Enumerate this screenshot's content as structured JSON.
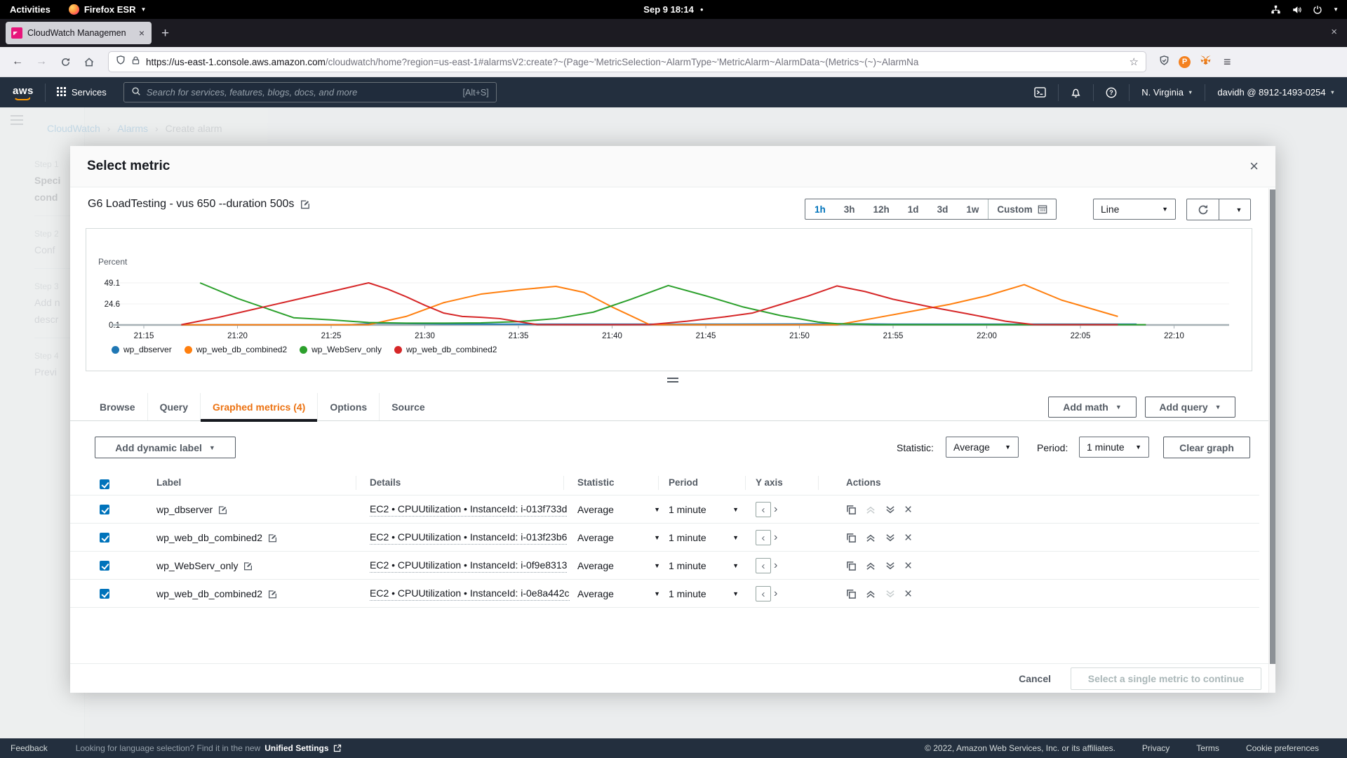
{
  "os": {
    "activities": "Activities",
    "browser_menu": "Firefox ESR",
    "clock": "Sep 9 18:14"
  },
  "browser": {
    "tab_title": "CloudWatch Managemen",
    "new_tab": "+",
    "url_domain": "https://us-east-1.console.aws.amazon.com",
    "url_path": "/cloudwatch/home?region=us-east-1#alarmsV2:create?~(Page~'MetricSelection~AlarmType~'MetricAlarm~AlarmData~(Metrics~(~)~AlarmNa"
  },
  "awsnav": {
    "services_label": "Services",
    "search_placeholder": "Search for services, features, blogs, docs, and more",
    "search_shortcut": "[Alt+S]",
    "region": "N. Virginia",
    "account": "davidh @ 8912-1493-0254"
  },
  "bg": {
    "breadcrumb": {
      "a": "CloudWatch",
      "b": "Alarms",
      "c": "Create alarm"
    },
    "steps": [
      {
        "k": "Step 1",
        "t1": "Speci",
        "t2": "cond"
      },
      {
        "k": "Step 2",
        "t1": "Conf",
        "t2": ""
      },
      {
        "k": "Step 3",
        "t1": "Add n",
        "t2": "descr"
      },
      {
        "k": "Step 4",
        "t1": "Previ",
        "t2": ""
      }
    ]
  },
  "modal": {
    "title": "Select metric",
    "graph_title": "G6 LoadTesting - vus 650 --duration 500s",
    "ranges": [
      "1h",
      "3h",
      "12h",
      "1d",
      "3d",
      "1w"
    ],
    "custom_label": "Custom",
    "line_label": "Line",
    "tabs": [
      "Browse",
      "Query",
      "Graphed metrics (4)",
      "Options",
      "Source"
    ],
    "add_math": "Add math",
    "add_query": "Add query",
    "add_dynamic_label": "Add dynamic label",
    "statistic_label": "Statistic:",
    "statistic_value": "Average",
    "period_label": "Period:",
    "period_value": "1 minute",
    "clear_graph": "Clear graph",
    "columns": {
      "label": "Label",
      "details": "Details",
      "statistic": "Statistic",
      "period": "Period",
      "yaxis": "Y axis",
      "actions": "Actions"
    },
    "rows": [
      {
        "color": "#1f77b4",
        "label": "wp_dbserver",
        "details": "EC2 • CPUUtilization • InstanceId: i-013f733d",
        "statistic": "Average",
        "period": "1 minute"
      },
      {
        "color": "#ff7f0e",
        "label": "wp_web_db_combined2",
        "details": "EC2 • CPUUtilization • InstanceId: i-013f23b6",
        "statistic": "Average",
        "period": "1 minute"
      },
      {
        "color": "#2ca02c",
        "label": "wp_WebServ_only",
        "details": "EC2 • CPUUtilization • InstanceId: i-0f9e8313",
        "statistic": "Average",
        "period": "1 minute"
      },
      {
        "color": "#d62728",
        "label": "wp_web_db_combined2",
        "details": "EC2 • CPUUtilization • InstanceId: i-0e8a442c",
        "statistic": "Average",
        "period": "1 minute"
      }
    ],
    "cancel": "Cancel",
    "submit": "Select a single metric to continue"
  },
  "chart_data": {
    "type": "line",
    "title": "G6 LoadTesting - vus 650 --duration 500s",
    "ylabel": "Percent",
    "yticks": [
      0.1,
      24.6,
      49.1
    ],
    "ylim": [
      0,
      55
    ],
    "grid": true,
    "legend_position": "bottom",
    "xticks": [
      "21:15",
      "21:20",
      "21:25",
      "21:30",
      "21:35",
      "21:40",
      "21:45",
      "21:50",
      "21:55",
      "22:00",
      "22:05",
      "22:10"
    ],
    "x_start_minute": 15,
    "x_tick_interval_minutes": 5,
    "series": [
      {
        "name": "wp_dbserver",
        "color": "#1f77b4",
        "points": [
          [
            17,
            0.3
          ],
          [
            20,
            0.3
          ],
          [
            23,
            0.3
          ],
          [
            26,
            0.4
          ],
          [
            27.5,
            2.2
          ],
          [
            29,
            1.8
          ],
          [
            31,
            1.2
          ],
          [
            34,
            1
          ],
          [
            38,
            1
          ],
          [
            42,
            1
          ],
          [
            46,
            1
          ],
          [
            50,
            1.2
          ],
          [
            52,
            1.5
          ],
          [
            55,
            1
          ],
          [
            59,
            1
          ],
          [
            63,
            1
          ],
          [
            66,
            1
          ],
          [
            68,
            1
          ]
        ]
      },
      {
        "name": "wp_web_db_combined2",
        "color": "#ff7f0e",
        "points": [
          [
            17,
            0.3
          ],
          [
            21,
            0.3
          ],
          [
            25,
            0.3
          ],
          [
            27,
            0.4
          ],
          [
            29,
            10
          ],
          [
            31,
            26
          ],
          [
            33,
            36
          ],
          [
            35,
            41
          ],
          [
            37,
            45
          ],
          [
            38.5,
            38
          ],
          [
            40,
            21
          ],
          [
            42,
            0.5
          ],
          [
            44,
            0.3
          ],
          [
            48,
            0.3
          ],
          [
            52,
            0.3
          ],
          [
            54,
            8
          ],
          [
            56,
            16
          ],
          [
            58,
            24
          ],
          [
            60,
            34
          ],
          [
            62,
            47
          ],
          [
            64,
            29
          ],
          [
            67,
            10
          ]
        ]
      },
      {
        "name": "wp_WebServ_only",
        "color": "#2ca02c",
        "points": [
          [
            18,
            49.1
          ],
          [
            20,
            31
          ],
          [
            23,
            8.5
          ],
          [
            25,
            6
          ],
          [
            27,
            3
          ],
          [
            29,
            2.2
          ],
          [
            31,
            2.2
          ],
          [
            33,
            2.6
          ],
          [
            35,
            4
          ],
          [
            37,
            7.5
          ],
          [
            39,
            15
          ],
          [
            41,
            30
          ],
          [
            43,
            46
          ],
          [
            45,
            34
          ],
          [
            47,
            21
          ],
          [
            49,
            11
          ],
          [
            51,
            3.5
          ],
          [
            52,
            1.5
          ],
          [
            54,
            0.4
          ],
          [
            57,
            0.4
          ],
          [
            60,
            0.4
          ],
          [
            63,
            0.4
          ],
          [
            66,
            0.4
          ],
          [
            68.5,
            0.4
          ]
        ]
      },
      {
        "name": "wp_web_db_combined2",
        "color": "#d62728",
        "points": [
          [
            17,
            0.4
          ],
          [
            19,
            9
          ],
          [
            21,
            19
          ],
          [
            23,
            29
          ],
          [
            25,
            39
          ],
          [
            27,
            49.1
          ],
          [
            28,
            42
          ],
          [
            29,
            33
          ],
          [
            30,
            23
          ],
          [
            31,
            14
          ],
          [
            32,
            10
          ],
          [
            33,
            9
          ],
          [
            34,
            7.5
          ],
          [
            35,
            4
          ],
          [
            36,
            0.5
          ],
          [
            38,
            0.4
          ],
          [
            40,
            0.4
          ],
          [
            42,
            0.5
          ],
          [
            44,
            4.5
          ],
          [
            46,
            9.5
          ],
          [
            47.5,
            14
          ],
          [
            49,
            24
          ],
          [
            50.5,
            34
          ],
          [
            52,
            45.5
          ],
          [
            53.5,
            39
          ],
          [
            55,
            30
          ],
          [
            57,
            21
          ],
          [
            59,
            13
          ],
          [
            61,
            4.5
          ],
          [
            62.5,
            0.5
          ],
          [
            64,
            0.4
          ],
          [
            67,
            0.4
          ]
        ]
      }
    ]
  },
  "footer_bar": {
    "feedback": "Feedback",
    "language_hint": "Looking for language selection? Find it in the new",
    "unified_settings": "Unified Settings",
    "copyright": "© 2022, Amazon Web Services, Inc. or its affiliates.",
    "privacy": "Privacy",
    "terms": "Terms",
    "cookie": "Cookie preferences"
  }
}
